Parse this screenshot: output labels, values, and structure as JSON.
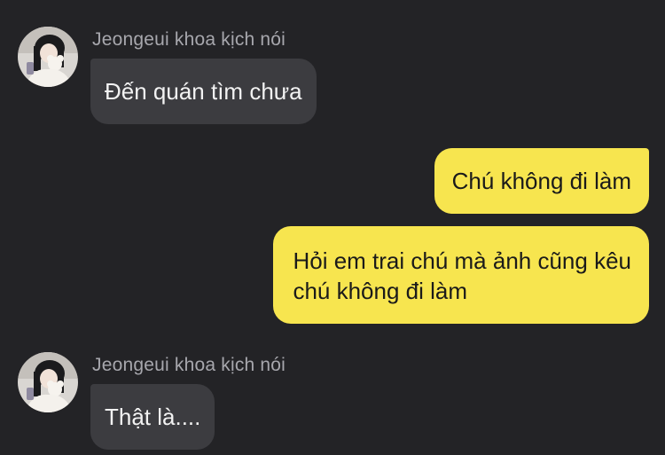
{
  "conversation": {
    "messages": [
      {
        "direction": "incoming",
        "sender": "Jeongeui khoa kịch nói",
        "lines": [
          "Đến quán tìm chưa"
        ]
      },
      {
        "direction": "outgoing",
        "lines": [
          "Chú không đi làm"
        ]
      },
      {
        "direction": "outgoing",
        "lines": [
          "Hỏi em trai chú mà ảnh cũng kêu",
          "chú không đi làm"
        ]
      },
      {
        "direction": "incoming",
        "sender": "Jeongeui khoa kịch nói",
        "lines": [
          "Thật là...."
        ]
      }
    ]
  },
  "colors": {
    "background": "#232326",
    "incoming_bubble": "#3c3c40",
    "outgoing_bubble": "#f7e54f",
    "sender_name": "#a7a7ad"
  },
  "icons": {
    "avatar": "profile-photo"
  }
}
